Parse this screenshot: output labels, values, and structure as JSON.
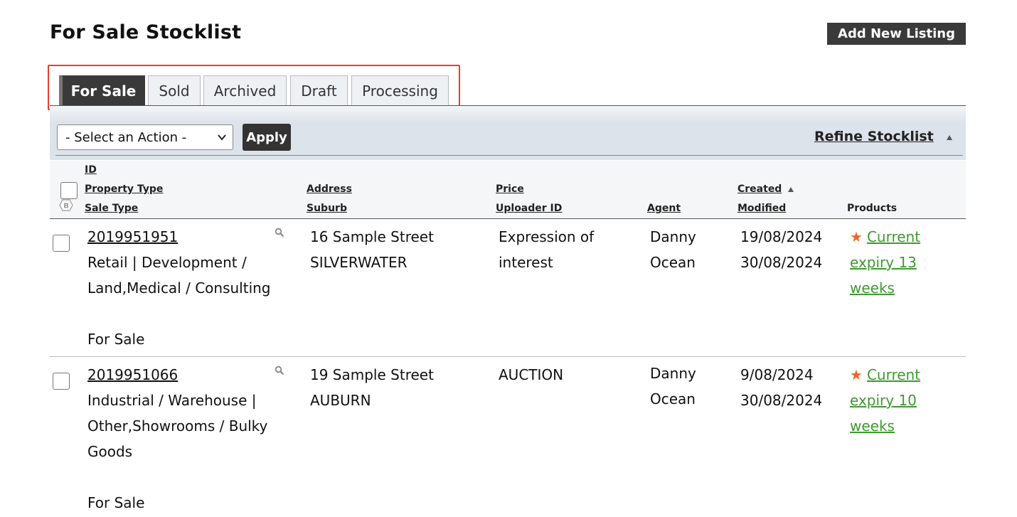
{
  "page": {
    "title": "For Sale Stocklist",
    "add_button": "Add New Listing"
  },
  "tabs": [
    {
      "label": "For Sale",
      "active": true
    },
    {
      "label": "Sold"
    },
    {
      "label": "Archived"
    },
    {
      "label": "Draft"
    },
    {
      "label": "Processing"
    }
  ],
  "toolbar": {
    "action_select": "- Select an Action -",
    "apply_label": "Apply",
    "refine_label": "Refine Stocklist"
  },
  "columns": {
    "id": "ID",
    "property_type": "Property Type",
    "sale_type": "Sale Type",
    "address": "Address",
    "suburb": "Suburb",
    "price": "Price",
    "uploader_id": "Uploader ID",
    "agent": "Agent",
    "created": "Created",
    "modified": "Modified",
    "products": "Products"
  },
  "rows": [
    {
      "id": "2019951951",
      "property_lines": [
        "Retail | Development /",
        "Land,Medical / Consulting"
      ],
      "sale_type": "For Sale",
      "address": "16 Sample Street",
      "suburb": "SILVERWATER",
      "price_lines": [
        "Expression of",
        "interest"
      ],
      "agent_lines": [
        "Danny",
        "Ocean"
      ],
      "created": "19/08/2024",
      "modified": "30/08/2024",
      "product_lines": [
        "Current",
        "expiry 13",
        "weeks"
      ]
    },
    {
      "id": "2019951066",
      "property_lines": [
        "Industrial / Warehouse |",
        "Other,Showrooms / Bulky",
        "Goods"
      ],
      "sale_type": "For Sale",
      "address": "19 Sample Street",
      "suburb": "AUBURN",
      "price_lines": [
        "AUCTION"
      ],
      "agent_lines": [
        "Danny",
        "Ocean"
      ],
      "created": "9/08/2024",
      "modified": "30/08/2024",
      "product_lines": [
        "Current",
        "expiry 10",
        "weeks"
      ]
    }
  ],
  "colors": {
    "accent_dark": "#3a3a3a",
    "highlight_border": "#e83e2e",
    "product_link": "#3d9a2f",
    "star": "#f0642a"
  }
}
